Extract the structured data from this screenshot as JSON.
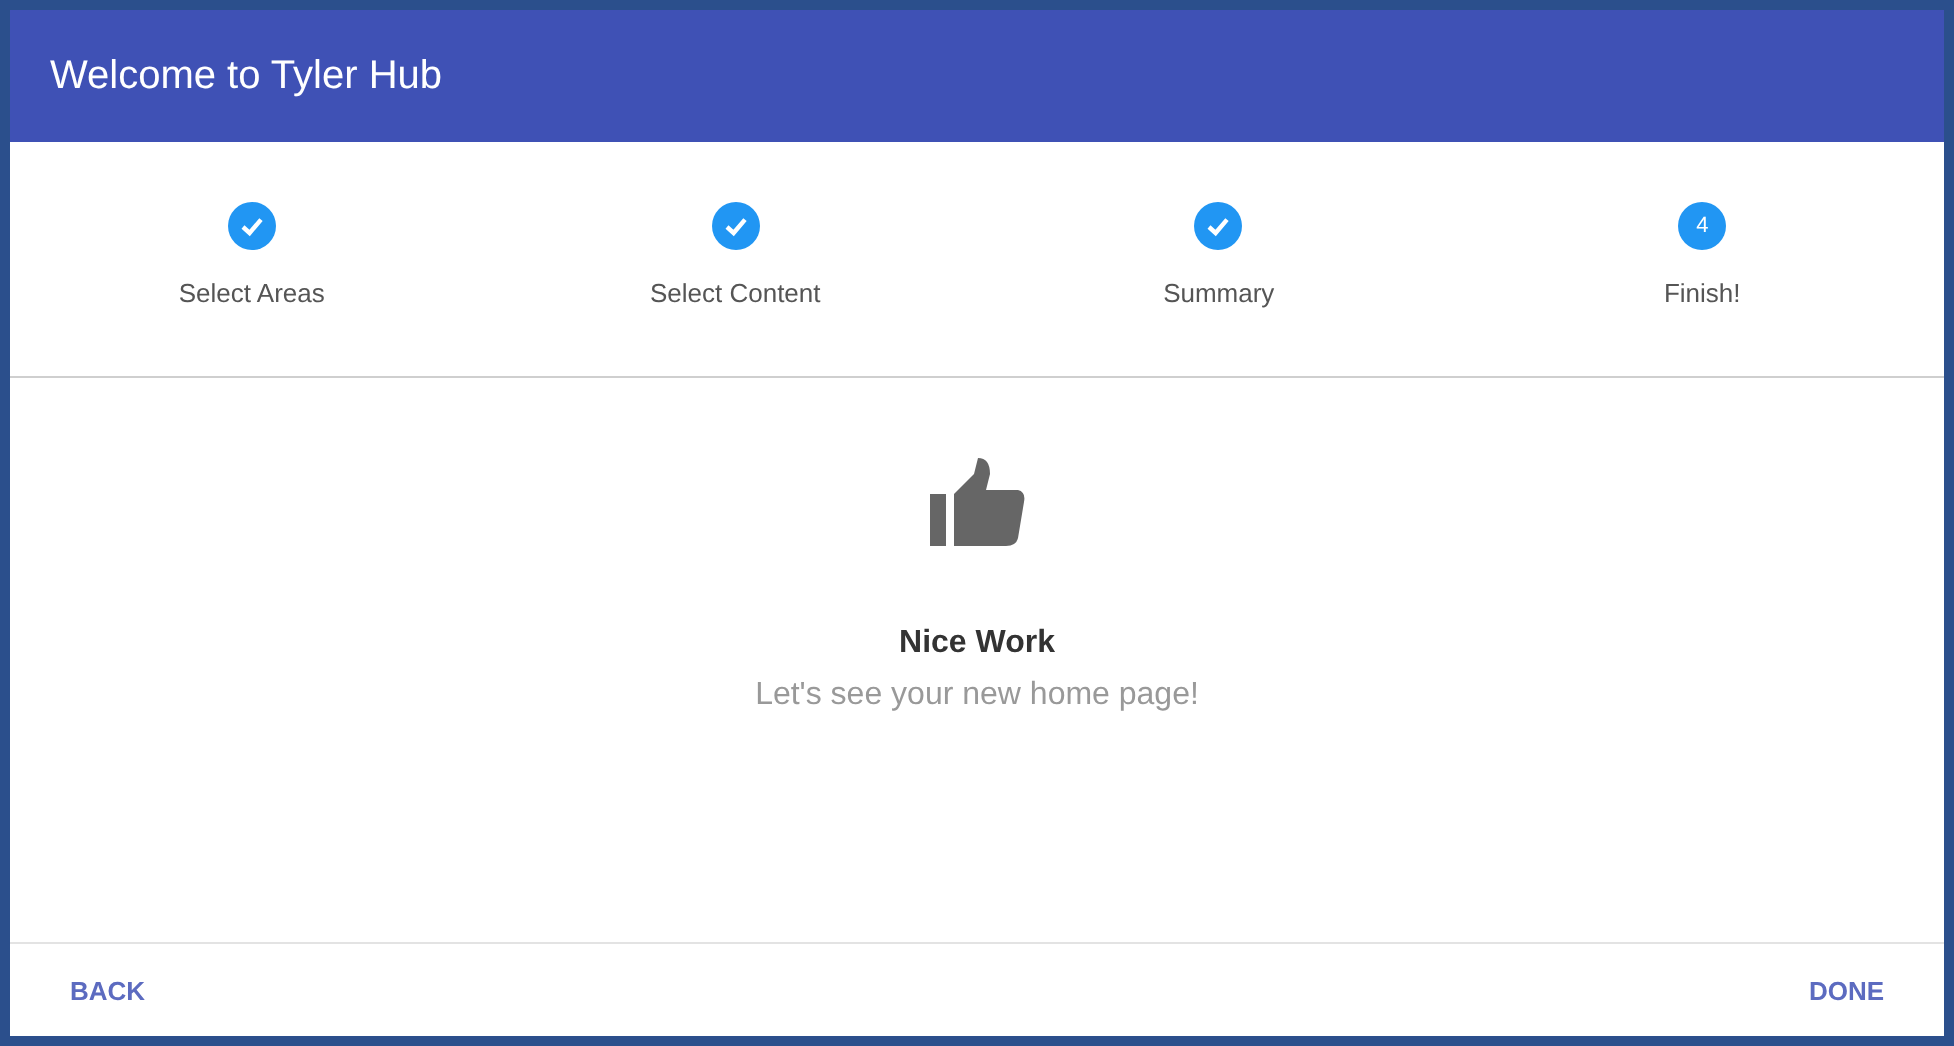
{
  "dialog": {
    "title": "Welcome to Tyler Hub"
  },
  "steps": [
    {
      "label": "Select Areas",
      "completed": true
    },
    {
      "label": "Select Content",
      "completed": true
    },
    {
      "label": "Summary",
      "completed": true
    },
    {
      "label": "Finish!",
      "completed": false,
      "number": "4"
    }
  ],
  "message": {
    "heading": "Nice Work",
    "text": "Let's see your new home page!"
  },
  "buttons": {
    "back": "BACK",
    "done": "DONE"
  }
}
